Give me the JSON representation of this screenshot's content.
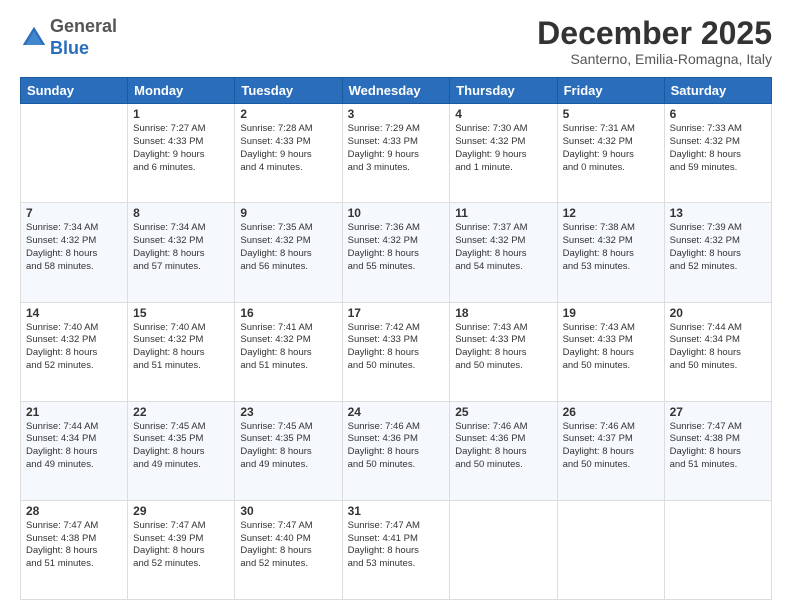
{
  "header": {
    "logo": {
      "general": "General",
      "blue": "Blue"
    },
    "title": "December 2025",
    "location": "Santerno, Emilia-Romagna, Italy"
  },
  "days_of_week": [
    "Sunday",
    "Monday",
    "Tuesday",
    "Wednesday",
    "Thursday",
    "Friday",
    "Saturday"
  ],
  "weeks": [
    [
      {
        "day": "",
        "info": ""
      },
      {
        "day": "1",
        "info": "Sunrise: 7:27 AM\nSunset: 4:33 PM\nDaylight: 9 hours\nand 6 minutes."
      },
      {
        "day": "2",
        "info": "Sunrise: 7:28 AM\nSunset: 4:33 PM\nDaylight: 9 hours\nand 4 minutes."
      },
      {
        "day": "3",
        "info": "Sunrise: 7:29 AM\nSunset: 4:33 PM\nDaylight: 9 hours\nand 3 minutes."
      },
      {
        "day": "4",
        "info": "Sunrise: 7:30 AM\nSunset: 4:32 PM\nDaylight: 9 hours\nand 1 minute."
      },
      {
        "day": "5",
        "info": "Sunrise: 7:31 AM\nSunset: 4:32 PM\nDaylight: 9 hours\nand 0 minutes."
      },
      {
        "day": "6",
        "info": "Sunrise: 7:33 AM\nSunset: 4:32 PM\nDaylight: 8 hours\nand 59 minutes."
      }
    ],
    [
      {
        "day": "7",
        "info": "Sunrise: 7:34 AM\nSunset: 4:32 PM\nDaylight: 8 hours\nand 58 minutes."
      },
      {
        "day": "8",
        "info": "Sunrise: 7:34 AM\nSunset: 4:32 PM\nDaylight: 8 hours\nand 57 minutes."
      },
      {
        "day": "9",
        "info": "Sunrise: 7:35 AM\nSunset: 4:32 PM\nDaylight: 8 hours\nand 56 minutes."
      },
      {
        "day": "10",
        "info": "Sunrise: 7:36 AM\nSunset: 4:32 PM\nDaylight: 8 hours\nand 55 minutes."
      },
      {
        "day": "11",
        "info": "Sunrise: 7:37 AM\nSunset: 4:32 PM\nDaylight: 8 hours\nand 54 minutes."
      },
      {
        "day": "12",
        "info": "Sunrise: 7:38 AM\nSunset: 4:32 PM\nDaylight: 8 hours\nand 53 minutes."
      },
      {
        "day": "13",
        "info": "Sunrise: 7:39 AM\nSunset: 4:32 PM\nDaylight: 8 hours\nand 52 minutes."
      }
    ],
    [
      {
        "day": "14",
        "info": "Sunrise: 7:40 AM\nSunset: 4:32 PM\nDaylight: 8 hours\nand 52 minutes."
      },
      {
        "day": "15",
        "info": "Sunrise: 7:40 AM\nSunset: 4:32 PM\nDaylight: 8 hours\nand 51 minutes."
      },
      {
        "day": "16",
        "info": "Sunrise: 7:41 AM\nSunset: 4:32 PM\nDaylight: 8 hours\nand 51 minutes."
      },
      {
        "day": "17",
        "info": "Sunrise: 7:42 AM\nSunset: 4:33 PM\nDaylight: 8 hours\nand 50 minutes."
      },
      {
        "day": "18",
        "info": "Sunrise: 7:43 AM\nSunset: 4:33 PM\nDaylight: 8 hours\nand 50 minutes."
      },
      {
        "day": "19",
        "info": "Sunrise: 7:43 AM\nSunset: 4:33 PM\nDaylight: 8 hours\nand 50 minutes."
      },
      {
        "day": "20",
        "info": "Sunrise: 7:44 AM\nSunset: 4:34 PM\nDaylight: 8 hours\nand 50 minutes."
      }
    ],
    [
      {
        "day": "21",
        "info": "Sunrise: 7:44 AM\nSunset: 4:34 PM\nDaylight: 8 hours\nand 49 minutes."
      },
      {
        "day": "22",
        "info": "Sunrise: 7:45 AM\nSunset: 4:35 PM\nDaylight: 8 hours\nand 49 minutes."
      },
      {
        "day": "23",
        "info": "Sunrise: 7:45 AM\nSunset: 4:35 PM\nDaylight: 8 hours\nand 49 minutes."
      },
      {
        "day": "24",
        "info": "Sunrise: 7:46 AM\nSunset: 4:36 PM\nDaylight: 8 hours\nand 50 minutes."
      },
      {
        "day": "25",
        "info": "Sunrise: 7:46 AM\nSunset: 4:36 PM\nDaylight: 8 hours\nand 50 minutes."
      },
      {
        "day": "26",
        "info": "Sunrise: 7:46 AM\nSunset: 4:37 PM\nDaylight: 8 hours\nand 50 minutes."
      },
      {
        "day": "27",
        "info": "Sunrise: 7:47 AM\nSunset: 4:38 PM\nDaylight: 8 hours\nand 51 minutes."
      }
    ],
    [
      {
        "day": "28",
        "info": "Sunrise: 7:47 AM\nSunset: 4:38 PM\nDaylight: 8 hours\nand 51 minutes."
      },
      {
        "day": "29",
        "info": "Sunrise: 7:47 AM\nSunset: 4:39 PM\nDaylight: 8 hours\nand 52 minutes."
      },
      {
        "day": "30",
        "info": "Sunrise: 7:47 AM\nSunset: 4:40 PM\nDaylight: 8 hours\nand 52 minutes."
      },
      {
        "day": "31",
        "info": "Sunrise: 7:47 AM\nSunset: 4:41 PM\nDaylight: 8 hours\nand 53 minutes."
      },
      {
        "day": "",
        "info": ""
      },
      {
        "day": "",
        "info": ""
      },
      {
        "day": "",
        "info": ""
      }
    ]
  ]
}
